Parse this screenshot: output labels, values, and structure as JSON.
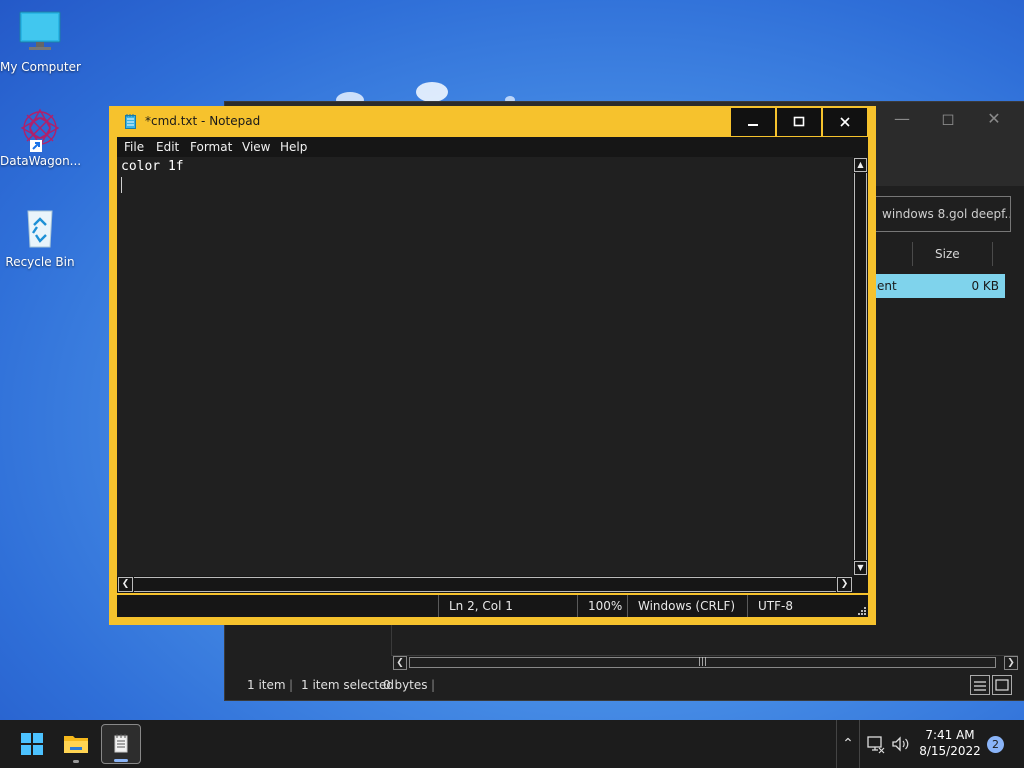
{
  "desktop": {
    "icons": [
      {
        "label": "My Computer"
      },
      {
        "label": "DataWagon..."
      },
      {
        "label": "Recycle Bin"
      }
    ]
  },
  "explorer": {
    "search_placeholder": "windows 8.gol deepf...",
    "columns": [
      "Size"
    ],
    "row": {
      "name_fragment": "ent",
      "size": "0 KB"
    },
    "status": {
      "items": "1 item",
      "selected": "1 item selected",
      "bytes": "0 bytes"
    }
  },
  "notepad": {
    "title": "*cmd.txt - Notepad",
    "menu": [
      "File",
      "Edit",
      "Format",
      "View",
      "Help"
    ],
    "content": "color 1f",
    "status": {
      "position": "Ln 2, Col 1",
      "zoom": "100%",
      "line_ending": "Windows (CRLF)",
      "encoding": "UTF-8"
    },
    "colors": {
      "border": "#f6c22d",
      "background": "#202020",
      "text": "#ffffff"
    }
  },
  "taskbar": {
    "clock_time": "7:41 AM",
    "clock_date": "8/15/2022",
    "notification_count": "2",
    "icons": [
      "start-icon",
      "file-explorer-icon",
      "notepad-icon",
      "network-icon",
      "volume-icon"
    ]
  }
}
